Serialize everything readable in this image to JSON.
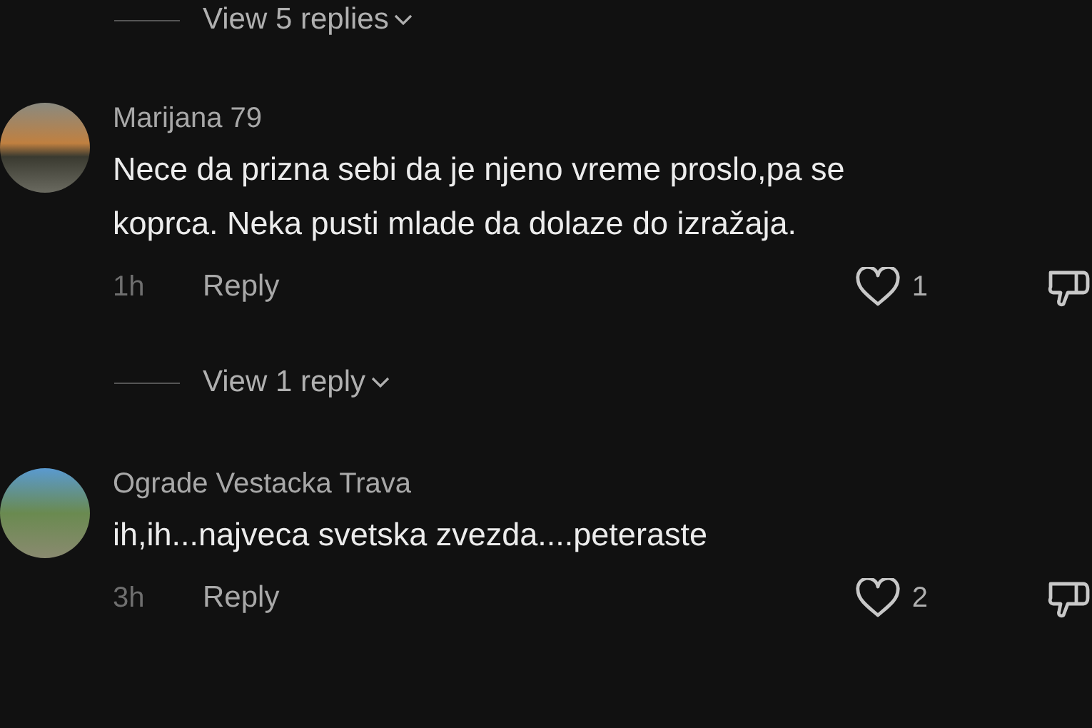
{
  "thread": [
    {
      "kind": "replies_toggle",
      "label": "View 5 replies"
    },
    {
      "kind": "comment",
      "author": "Marijana 79",
      "text_lines": [
        "Nece da prizna sebi da je njeno vreme proslo,pa se",
        "koprca. Neka pusti mlade da dolaze do izražaja."
      ],
      "time": "1h",
      "reply": "Reply",
      "likes": "1"
    },
    {
      "kind": "replies_toggle",
      "label": "View 1 reply"
    },
    {
      "kind": "comment",
      "author": "Ograde Vestacka Trava",
      "text_lines": [
        "ih,ih...najveca svetska zvezda....peteraste"
      ],
      "time": "3h",
      "reply": "Reply",
      "likes": "2"
    }
  ]
}
